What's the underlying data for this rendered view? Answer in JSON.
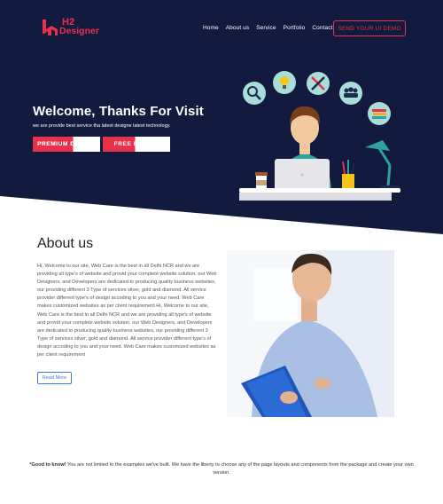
{
  "brand": {
    "line1": "H2",
    "line2": "Designer"
  },
  "nav": {
    "items": [
      "Home",
      "About us",
      "Service",
      "Portfolio",
      "Contact"
    ]
  },
  "header": {
    "cta_label": "SEND YOUR UI DEMO"
  },
  "hero": {
    "title": "Welcome, Thanks For Visit",
    "subtitle": "we are provide best service tha latest designe latest technology.",
    "buttons": {
      "premium": "PREMIUM DESIGN",
      "free": "FREE DESIGN"
    }
  },
  "about": {
    "title": "About us",
    "body": "Hi, Welcome to our site, Web Care is the best in all Delhi NCR and we are providing all type's of website and provid your complete website solution. our Web Designers, and Developers are dedicated to producing quality business websites, our providing different 3 Type of services silver, gold and diamond. All service provider different type's of design accoding to you and your need. Web Care makes customized websites as per client requirement.Hi, Welcome to our site, Web Care is the best in all Delhi NCR and we are providing all type's of website and provid your complete website solution. our Web Designers, and Developers are dedicated to producing quality business websites, our providing different 3 Type of services silver, gold and diamond. All service provider different type's of design accoding to you and your need. Web Care makes customized websites as per client requirement",
    "read_more": "Read More"
  },
  "footer": {
    "bold": "*Good to know!",
    "text": " You are not limited to the examples we've built. We have the liberty to choose any of the page layouts and components from the package and create your own version."
  },
  "colors": {
    "navy": "#121a3e",
    "accent": "#e8314b",
    "link": "#3b7dd8",
    "teal": "#2fa39b"
  },
  "icons": [
    "search-icon",
    "lightbulb-icon",
    "pencil-ruler-icon",
    "team-icon",
    "books-icon"
  ]
}
